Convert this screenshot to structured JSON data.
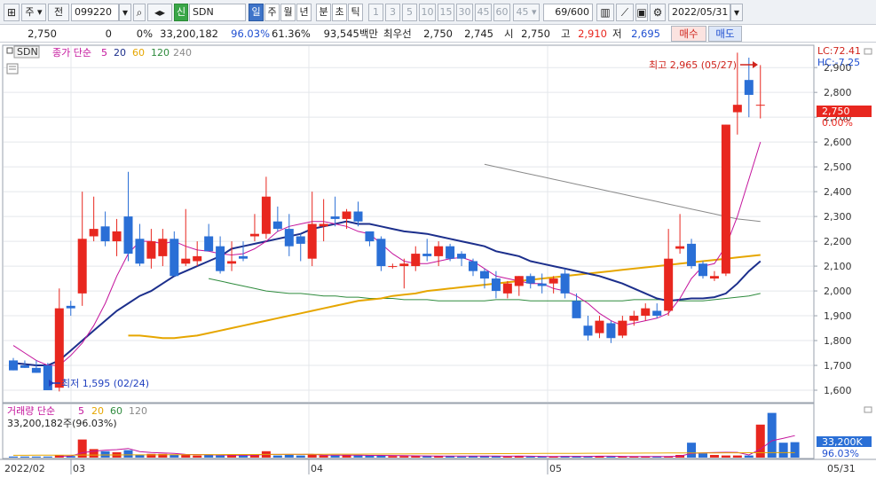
{
  "toolbar": {
    "period_selector": "주",
    "all_selector": "전",
    "stock_code": "099220",
    "new_badge": "신",
    "stock_name": "SDN",
    "timeframes": [
      "일",
      "주",
      "월",
      "년",
      "분",
      "초",
      "틱"
    ],
    "active_timeframe": "일",
    "intervals": [
      "1",
      "3",
      "5",
      "10",
      "15",
      "30",
      "45",
      "60"
    ],
    "interval_custom": "45",
    "candle_count": "69/600",
    "date": "2022/05/31"
  },
  "quote": {
    "price": "2,750",
    "change": "0",
    "change_pct": "0%",
    "volume": "33,200,182",
    "volume_pct": "96.03%",
    "ratio": "61.36%",
    "amount": "93,545백만",
    "best_label": "최우선",
    "best_ask": "2,750",
    "best_bid": "2,745",
    "open_label": "시",
    "open": "2,750",
    "high_label": "고",
    "high": "2,910",
    "low_label": "저",
    "low": "2,695",
    "buy_button": "매수",
    "sell_button": "매도"
  },
  "legend": {
    "name": "SDN",
    "ma_label": "종가 단순",
    "ma_periods": [
      "5",
      "20",
      "60",
      "120",
      "240"
    ],
    "ma_colors": [
      "#c4149c",
      "#1c2f8c",
      "#e6a600",
      "#2e8b3d",
      "#8a8a8a"
    ]
  },
  "volume_legend": {
    "label": "거래량 단순",
    "periods": [
      "5",
      "20",
      "60",
      "120"
    ],
    "colors": [
      "#c4149c",
      "#e6a600",
      "#2e8b3d",
      "#8a8a8a"
    ],
    "current": "33,200,182주(96.03%)"
  },
  "annotations": {
    "high": "최고 2,965 (05/27)",
    "low": "최저 1,595 (02/24)"
  },
  "right_axis": {
    "lc": "LC:72.41",
    "hc": "HC:-7.25",
    "price_tag": "2,750",
    "price_pct": "0.00%",
    "volume_tag": "33,200K",
    "volume_pct": "96.03%",
    "ticks": [
      "2,900",
      "2,800",
      "2,700",
      "2,600",
      "2,500",
      "2,400",
      "2,300",
      "2,200",
      "2,100",
      "2,000",
      "1,900",
      "1,800",
      "1,700",
      "1,600"
    ]
  },
  "x_axis": {
    "labels": [
      "2022/02",
      "03",
      "04",
      "05"
    ],
    "last_date": "05/31"
  },
  "colors": {
    "up": "#e8271f",
    "down": "#2a6fd6",
    "ma5": "#c4149c",
    "ma20": "#1c2f8c",
    "ma60": "#e6a600",
    "ma120": "#2e8b3d",
    "ma240": "#8a8a8a"
  },
  "chart_data": {
    "type": "candlestick",
    "y_range": [
      1550,
      2990
    ],
    "candles": [
      {
        "o": 1720,
        "h": 1730,
        "l": 1680,
        "c": 1680
      },
      {
        "o": 1700,
        "h": 1720,
        "l": 1690,
        "c": 1690
      },
      {
        "o": 1690,
        "h": 1720,
        "l": 1670,
        "c": 1670
      },
      {
        "o": 1700,
        "h": 1710,
        "l": 1600,
        "c": 1600
      },
      {
        "o": 1610,
        "h": 2010,
        "l": 1595,
        "c": 1930
      },
      {
        "o": 1940,
        "h": 1960,
        "l": 1900,
        "c": 1930
      },
      {
        "o": 1990,
        "h": 2400,
        "l": 1940,
        "c": 2210
      },
      {
        "o": 2220,
        "h": 2380,
        "l": 2200,
        "c": 2250
      },
      {
        "o": 2260,
        "h": 2320,
        "l": 2180,
        "c": 2200
      },
      {
        "o": 2200,
        "h": 2290,
        "l": 2140,
        "c": 2240
      },
      {
        "o": 2300,
        "h": 2480,
        "l": 2120,
        "c": 2150
      },
      {
        "o": 2210,
        "h": 2270,
        "l": 2100,
        "c": 2110
      },
      {
        "o": 2130,
        "h": 2250,
        "l": 2090,
        "c": 2200
      },
      {
        "o": 2140,
        "h": 2250,
        "l": 2100,
        "c": 2210
      },
      {
        "o": 2210,
        "h": 2240,
        "l": 2060,
        "c": 2060
      },
      {
        "o": 2110,
        "h": 2330,
        "l": 2100,
        "c": 2130
      },
      {
        "o": 2120,
        "h": 2200,
        "l": 2100,
        "c": 2140
      },
      {
        "o": 2220,
        "h": 2270,
        "l": 2200,
        "c": 2160
      },
      {
        "o": 2180,
        "h": 2220,
        "l": 2070,
        "c": 2080
      },
      {
        "o": 2110,
        "h": 2200,
        "l": 2080,
        "c": 2120
      },
      {
        "o": 2140,
        "h": 2200,
        "l": 2120,
        "c": 2130
      },
      {
        "o": 2220,
        "h": 2310,
        "l": 2200,
        "c": 2230
      },
      {
        "o": 2230,
        "h": 2460,
        "l": 2210,
        "c": 2380
      },
      {
        "o": 2280,
        "h": 2340,
        "l": 2240,
        "c": 2250
      },
      {
        "o": 2250,
        "h": 2310,
        "l": 2140,
        "c": 2180
      },
      {
        "o": 2220,
        "h": 2230,
        "l": 2120,
        "c": 2190
      },
      {
        "o": 2130,
        "h": 2400,
        "l": 2100,
        "c": 2270
      },
      {
        "o": 2260,
        "h": 2370,
        "l": 2200,
        "c": 2270
      },
      {
        "o": 2300,
        "h": 2380,
        "l": 2260,
        "c": 2290
      },
      {
        "o": 2290,
        "h": 2330,
        "l": 2250,
        "c": 2320
      },
      {
        "o": 2320,
        "h": 2360,
        "l": 2260,
        "c": 2280
      },
      {
        "o": 2240,
        "h": 2220,
        "l": 2180,
        "c": 2200
      },
      {
        "o": 2210,
        "h": 2220,
        "l": 2080,
        "c": 2100
      },
      {
        "o": 2100,
        "h": 2110,
        "l": 2090,
        "c": 2100
      },
      {
        "o": 2100,
        "h": 2130,
        "l": 2010,
        "c": 2110
      },
      {
        "o": 2100,
        "h": 2180,
        "l": 2080,
        "c": 2150
      },
      {
        "o": 2150,
        "h": 2210,
        "l": 2120,
        "c": 2140
      },
      {
        "o": 2140,
        "h": 2200,
        "l": 2100,
        "c": 2180
      },
      {
        "o": 2180,
        "h": 2190,
        "l": 2120,
        "c": 2130
      },
      {
        "o": 2150,
        "h": 2160,
        "l": 2100,
        "c": 2130
      },
      {
        "o": 2120,
        "h": 2130,
        "l": 2060,
        "c": 2080
      },
      {
        "o": 2080,
        "h": 2090,
        "l": 2010,
        "c": 2050
      },
      {
        "o": 2050,
        "h": 2080,
        "l": 1970,
        "c": 2000
      },
      {
        "o": 1990,
        "h": 2040,
        "l": 1970,
        "c": 2030
      },
      {
        "o": 2020,
        "h": 2060,
        "l": 1980,
        "c": 2060
      },
      {
        "o": 2060,
        "h": 2070,
        "l": 2010,
        "c": 2030
      },
      {
        "o": 2030,
        "h": 2070,
        "l": 1990,
        "c": 2020
      },
      {
        "o": 2030,
        "h": 2060,
        "l": 1990,
        "c": 2050
      },
      {
        "o": 2070,
        "h": 2090,
        "l": 1970,
        "c": 1990
      },
      {
        "o": 1960,
        "h": 1990,
        "l": 1900,
        "c": 1890
      },
      {
        "o": 1860,
        "h": 1900,
        "l": 1800,
        "c": 1820
      },
      {
        "o": 1830,
        "h": 1900,
        "l": 1810,
        "c": 1880
      },
      {
        "o": 1870,
        "h": 1880,
        "l": 1790,
        "c": 1810
      },
      {
        "o": 1820,
        "h": 1900,
        "l": 1810,
        "c": 1880
      },
      {
        "o": 1880,
        "h": 1920,
        "l": 1860,
        "c": 1900
      },
      {
        "o": 1900,
        "h": 1950,
        "l": 1880,
        "c": 1930
      },
      {
        "o": 1920,
        "h": 1950,
        "l": 1890,
        "c": 1900
      },
      {
        "o": 1920,
        "h": 2250,
        "l": 1900,
        "c": 2130
      },
      {
        "o": 2170,
        "h": 2310,
        "l": 2150,
        "c": 2180
      },
      {
        "o": 2190,
        "h": 2210,
        "l": 2090,
        "c": 2100
      },
      {
        "o": 2110,
        "h": 2120,
        "l": 2050,
        "c": 2060
      },
      {
        "o": 2050,
        "h": 2080,
        "l": 2040,
        "c": 2060
      },
      {
        "o": 2070,
        "h": 2670,
        "l": 2060,
        "c": 2670
      },
      {
        "o": 2720,
        "h": 2960,
        "l": 2630,
        "c": 2750
      },
      {
        "o": 2850,
        "h": 2940,
        "l": 2700,
        "c": 2790
      },
      {
        "o": 2750,
        "h": 2910,
        "l": 2695,
        "c": 2750
      }
    ],
    "volumes": [
      0.02,
      0.02,
      0.02,
      0.02,
      0.05,
      0.03,
      0.34,
      0.16,
      0.12,
      0.1,
      0.14,
      0.05,
      0.07,
      0.07,
      0.06,
      0.05,
      0.04,
      0.05,
      0.04,
      0.05,
      0.04,
      0.05,
      0.12,
      0.04,
      0.05,
      0.04,
      0.06,
      0.04,
      0.04,
      0.05,
      0.04,
      0.04,
      0.04,
      0.03,
      0.03,
      0.03,
      0.03,
      0.03,
      0.03,
      0.02,
      0.03,
      0.03,
      0.03,
      0.02,
      0.03,
      0.02,
      0.02,
      0.02,
      0.03,
      0.03,
      0.02,
      0.03,
      0.02,
      0.02,
      0.02,
      0.02,
      0.02,
      0.02,
      0.05,
      0.28,
      0.08,
      0.05,
      0.04,
      0.04,
      0.04,
      0.62,
      0.84,
      0.28,
      0.29
    ],
    "ma5": [
      1780,
      1750,
      1720,
      1700,
      1700,
      1740,
      1790,
      1860,
      1950,
      2060,
      2150,
      2200,
      2200,
      2190,
      2200,
      2180,
      2165,
      2160,
      2150,
      2145,
      2150,
      2170,
      2200,
      2240,
      2260,
      2270,
      2280,
      2280,
      2270,
      2260,
      2240,
      2230,
      2190,
      2150,
      2120,
      2110,
      2110,
      2120,
      2130,
      2135,
      2120,
      2090,
      2060,
      2050,
      2040,
      2030,
      2030,
      2010,
      2000,
      1980,
      1950,
      1910,
      1880,
      1860,
      1870,
      1880,
      1890,
      1910,
      1970,
      2050,
      2100,
      2110,
      2180,
      2300,
      2450,
      2600
    ],
    "ma20": [
      1710,
      1705,
      1700,
      1700,
      1720,
      1760,
      1800,
      1840,
      1880,
      1920,
      1950,
      1980,
      2000,
      2030,
      2060,
      2080,
      2100,
      2120,
      2140,
      2170,
      2180,
      2190,
      2200,
      2210,
      2220,
      2230,
      2250,
      2260,
      2270,
      2280,
      2270,
      2270,
      2260,
      2250,
      2240,
      2235,
      2230,
      2220,
      2210,
      2200,
      2190,
      2180,
      2160,
      2150,
      2140,
      2120,
      2110,
      2100,
      2090,
      2080,
      2070,
      2060,
      2045,
      2030,
      2010,
      1990,
      1970,
      1960,
      1965,
      1970,
      1970,
      1975,
      1990,
      2030,
      2080,
      2120
    ],
    "ma60": [
      1820,
      1820,
      1815,
      1810,
      1810,
      1815,
      1820,
      1830,
      1840,
      1850,
      1860,
      1870,
      1880,
      1890,
      1900,
      1910,
      1920,
      1930,
      1940,
      1950,
      1960,
      1965,
      1970,
      1980,
      1985,
      1990,
      2000,
      2005,
      2010,
      2015,
      2020,
      2025,
      2030,
      2035,
      2040,
      2045,
      2050,
      2055,
      2060,
      2065,
      2070,
      2075,
      2080,
      2085,
      2090,
      2095,
      2100,
      2105,
      2110,
      2115,
      2120,
      2125,
      2130,
      2135,
      2140,
      2145
    ],
    "ma120": [
      2050,
      2040,
      2030,
      2020,
      2010,
      2000,
      1995,
      1990,
      1990,
      1985,
      1980,
      1980,
      1975,
      1975,
      1970,
      1970,
      1970,
      1965,
      1965,
      1965,
      1960,
      1960,
      1960,
      1960,
      1960,
      1965,
      1965,
      1965,
      1960,
      1960,
      1960,
      1960,
      1960,
      1960,
      1960,
      1960,
      1960,
      1965,
      1965,
      1965,
      1965,
      1960,
      1960,
      1960,
      1965,
      1970,
      1975,
      1980,
      1990
    ],
    "ma240": [
      2510,
      2500,
      2490,
      2480,
      2470,
      2460,
      2450,
      2440,
      2430,
      2420,
      2410,
      2400,
      2390,
      2380,
      2370,
      2360,
      2350,
      2340,
      2330,
      2320,
      2310,
      2300,
      2290,
      2285,
      2280
    ]
  }
}
